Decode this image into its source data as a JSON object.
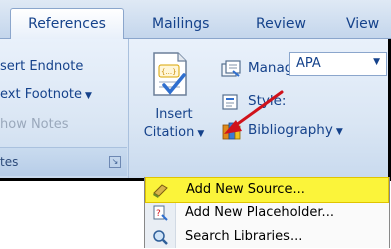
{
  "tabs": [
    {
      "label": "References",
      "active": true
    },
    {
      "label": "Mailings",
      "active": false
    },
    {
      "label": "Review",
      "active": false
    },
    {
      "label": "View",
      "active": false
    }
  ],
  "left_group": {
    "items": [
      "sert Endnote",
      "ext Footnote",
      "how Notes"
    ],
    "label": "tes"
  },
  "insert_citation": {
    "line1": "Insert",
    "line2": "Citation"
  },
  "manage_sources": "Manage Sources",
  "style": {
    "label": "Style:",
    "value": "APA"
  },
  "bibliography": "Bibliography",
  "menu": {
    "items": [
      {
        "label": "Add New Source...",
        "highlighted": true
      },
      {
        "label": "Add New Placeholder...",
        "highlighted": false
      },
      {
        "label": "Search Libraries...",
        "highlighted": false
      }
    ]
  },
  "colors": {
    "accent_highlight": "#fbf43a",
    "ribbon_text": "#15428b",
    "arrow": "#d0121b"
  }
}
